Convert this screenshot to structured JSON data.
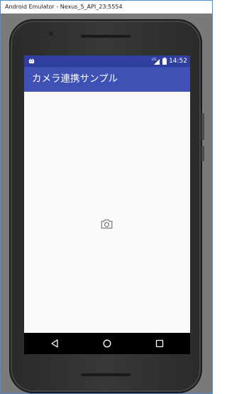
{
  "window": {
    "title": "Android Emulator - Nexus_5_API_23:5554",
    "border_color": "#4a90d9",
    "stage_color": "#7a7a7a"
  },
  "statusbar": {
    "color": "#303f9f",
    "left_icon": "android-notification-icon",
    "right_icons": [
      "lte-signal-icon",
      "battery-icon"
    ],
    "time": "14:52"
  },
  "appbar": {
    "color": "#3f51b5",
    "title": "カメラ連携サンプル"
  },
  "content": {
    "center_icon": "camera-icon"
  },
  "navbar": {
    "buttons": [
      "back-icon",
      "home-icon",
      "recents-icon"
    ]
  }
}
